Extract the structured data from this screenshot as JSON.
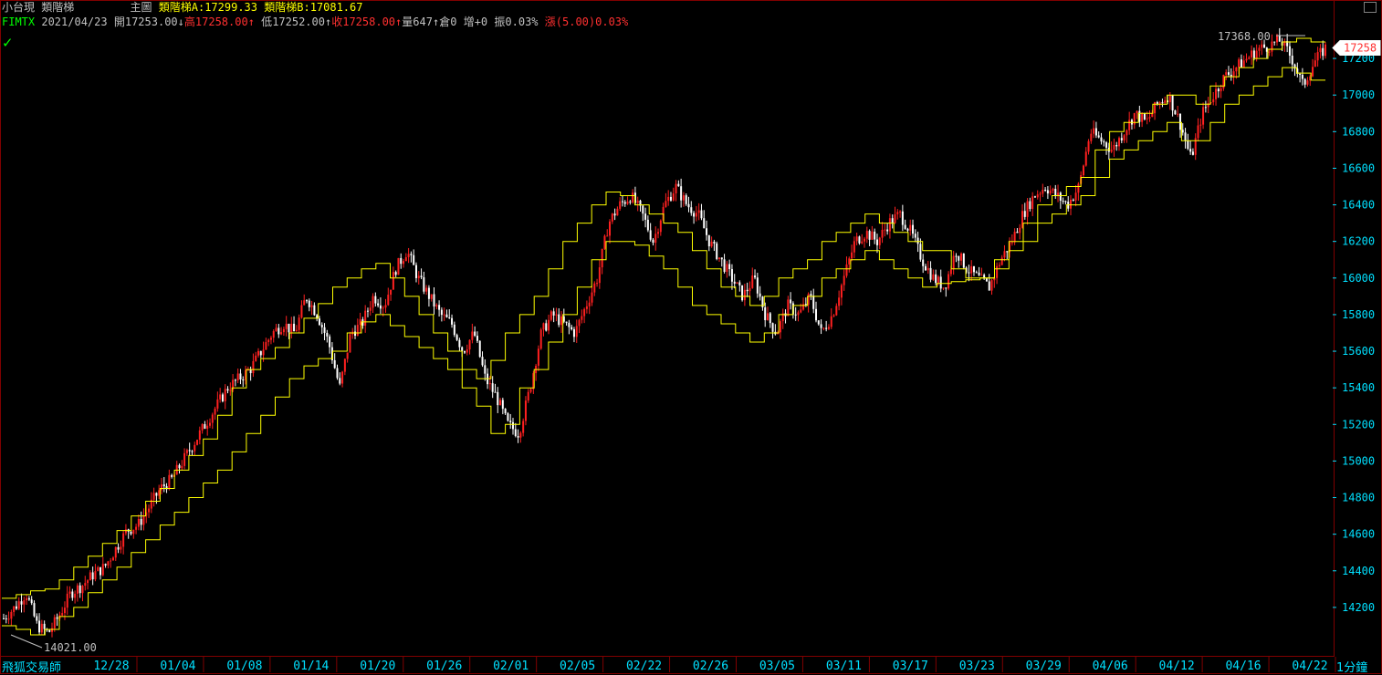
{
  "header": {
    "symbol_name": "小台現",
    "indicator": "類階梯",
    "panel": "主圖",
    "ind_a_label": "類階梯A:",
    "ind_a_value": "17299.33",
    "ind_b_label": "類階梯B:",
    "ind_b_value": "17081.67",
    "code": "FIMTX",
    "date": "2021/04/23",
    "open_label": "開",
    "open": "17253.00",
    "high_label": "高",
    "high": "17258.00",
    "low_label": "低",
    "low": "17252.00",
    "close_label": "收",
    "close": "17258.00",
    "vol_label": "量",
    "vol": "647",
    "oi_label": "倉",
    "oi": "0",
    "chg_label": "增",
    "chg": "+0",
    "amp_label": "振",
    "amp": "0.03%",
    "ud_label": "漲",
    "ud": "(5.00)0.03%",
    "arrow_down": "↓",
    "arrow_up": "↑"
  },
  "footer": {
    "brand": "飛狐交易師",
    "period": "1分鐘"
  },
  "colors": {
    "background": "#000000",
    "frame": "#800000",
    "axis_text": "#00e0ff",
    "ladder": "#ffff00",
    "candle_up": "#ff2020",
    "candle_down": "#ffffff",
    "price_tag": "#ff3030"
  },
  "icons": {
    "ok": "check-icon"
  },
  "chart_data": {
    "type": "candlestick",
    "x_ticks": [
      "12/28",
      "01/04",
      "01/08",
      "01/14",
      "01/20",
      "01/26",
      "02/01",
      "02/05",
      "02/22",
      "02/26",
      "03/05",
      "03/11",
      "03/17",
      "03/23",
      "03/29",
      "04/06",
      "04/12",
      "04/16",
      "04/22"
    ],
    "y_ticks": [
      14200,
      14400,
      14600,
      14800,
      15000,
      15200,
      15400,
      15600,
      15800,
      16000,
      16200,
      16400,
      16600,
      16800,
      17000,
      17200
    ],
    "ylim": [
      14030,
      17320
    ],
    "high_annotation": "17368.00",
    "low_annotation": "14021.00",
    "last_price_tag": "17258",
    "series": [
      {
        "name": "類階梯A",
        "values": [
          14250,
          14270,
          14290,
          14300,
          14350,
          14420,
          14480,
          14550,
          14620,
          14700,
          14780,
          14850,
          14950,
          15030,
          15120,
          15250,
          15400,
          15500,
          15560,
          15620,
          15700,
          15780,
          15860,
          15950,
          16000,
          16050,
          16080,
          16000,
          15900,
          15800,
          15700,
          15600,
          15500,
          15450,
          15550,
          15700,
          15800,
          15900,
          16050,
          16200,
          16300,
          16400,
          16470,
          16450,
          16400,
          16350,
          16300,
          16250,
          16150,
          16050,
          15950,
          15900,
          15850,
          15900,
          16000,
          16050,
          16100,
          16200,
          16250,
          16300,
          16350,
          16300,
          16250,
          16200,
          16150,
          16150,
          16050,
          16000,
          16000,
          16100,
          16200,
          16300,
          16400,
          16450,
          16500,
          16550,
          16700,
          16800,
          16850,
          16900,
          16950,
          17000,
          17000,
          16950,
          17050,
          17100,
          17150,
          17200,
          17250,
          17290,
          17310,
          17290
        ]
      },
      {
        "name": "類階梯B",
        "values": [
          14100,
          14080,
          14050,
          14080,
          14150,
          14200,
          14280,
          14350,
          14420,
          14500,
          14570,
          14650,
          14720,
          14800,
          14880,
          14950,
          15050,
          15150,
          15250,
          15350,
          15450,
          15520,
          15560,
          15600,
          15700,
          15760,
          15800,
          15740,
          15680,
          15620,
          15560,
          15500,
          15400,
          15300,
          15150,
          15200,
          15400,
          15500,
          15650,
          15800,
          15950,
          16100,
          16200,
          16200,
          16180,
          16120,
          16050,
          15950,
          15850,
          15800,
          15750,
          15700,
          15650,
          15700,
          15800,
          15850,
          15900,
          16000,
          16050,
          16100,
          16150,
          16100,
          16050,
          16000,
          15950,
          15970,
          15980,
          15990,
          16000,
          16050,
          16150,
          16200,
          16300,
          16350,
          16400,
          16450,
          16550,
          16650,
          16700,
          16750,
          16800,
          16850,
          16750,
          16750,
          16850,
          16950,
          17000,
          17050,
          17100,
          17150,
          17120,
          17081
        ]
      }
    ],
    "close_path": [
      14140,
      14200,
      14280,
      14100,
      14060,
      14160,
      14280,
      14320,
      14380,
      14420,
      14520,
      14620,
      14650,
      14750,
      14850,
      14900,
      15000,
      15100,
      15200,
      15300,
      15400,
      15450,
      15500,
      15600,
      15700,
      15750,
      15700,
      15900,
      15800,
      15650,
      15400,
      15700,
      15750,
      15900,
      15850,
      16050,
      16150,
      16000,
      15900,
      15800,
      15750,
      15600,
      15700,
      15450,
      15350,
      15200,
      15150,
      15400,
      15700,
      15800,
      15750,
      15700,
      15850,
      16000,
      16300,
      16400,
      16450,
      16350,
      16200,
      16400,
      16500,
      16400,
      16350,
      16200,
      16100,
      16000,
      15900,
      16000,
      15800,
      15700,
      15850,
      15800,
      15900,
      15700,
      15800,
      16000,
      16200,
      16250,
      16200,
      16300,
      16350,
      16250,
      16100,
      16000,
      15950,
      16150,
      16050,
      16000,
      15950,
      16100,
      16200,
      16350,
      16450,
      16500,
      16450,
      16400,
      16500,
      16800,
      16750,
      16700,
      16800,
      16900,
      16850,
      16950,
      17000,
      16850,
      16650,
      16900,
      17000,
      17100,
      17150,
      17200,
      17250,
      17270,
      17300,
      17200,
      17050,
      17180,
      17258
    ]
  }
}
